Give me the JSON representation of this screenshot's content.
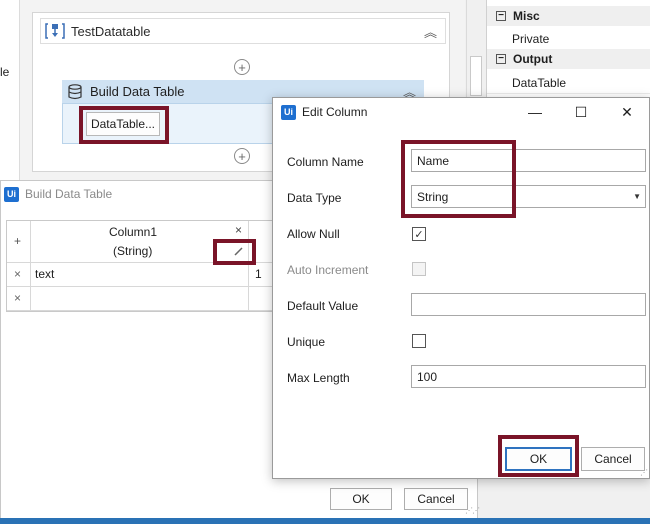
{
  "designer": {
    "left_cut_text": "le",
    "sequence_title": "TestDatatable",
    "activity_title": "Build Data Table",
    "datatable_button": "DataTable..."
  },
  "properties": {
    "category_misc": "Misc",
    "category_misc_expander": "−",
    "row_private": "Private",
    "category_output": "Output",
    "category_output_expander": "−",
    "row_datatable": "DataTable"
  },
  "build_dialog": {
    "title": "Build Data Table",
    "logo": "Ui",
    "column_header_name": "Column1",
    "column_header_type": "(String)",
    "add_symbol": "+",
    "remove_symbol": "×",
    "row1_value": "text",
    "row1_cut_value": "1",
    "ok_label": "OK",
    "cancel_label": "Cancel"
  },
  "edit_column": {
    "title": "Edit Column",
    "logo": "Ui",
    "minimize": "—",
    "maximize": "☐",
    "close": "✕",
    "labels": {
      "column_name": "Column Name",
      "data_type": "Data Type",
      "allow_null": "Allow Null",
      "auto_increment": "Auto Increment",
      "default_value": "Default Value",
      "unique": "Unique",
      "max_length": "Max Length"
    },
    "values": {
      "column_name": "Name",
      "data_type": "String",
      "allow_null_checked": "✓",
      "default_value": "",
      "max_length": "100"
    },
    "ok_label": "OK",
    "cancel_label": "Cancel"
  },
  "colors": {
    "highlight": "#7a1428",
    "ui_logo": "#1e6fd0",
    "activity_header": "#cfe2f3",
    "taskbar": "#2a72b5"
  }
}
